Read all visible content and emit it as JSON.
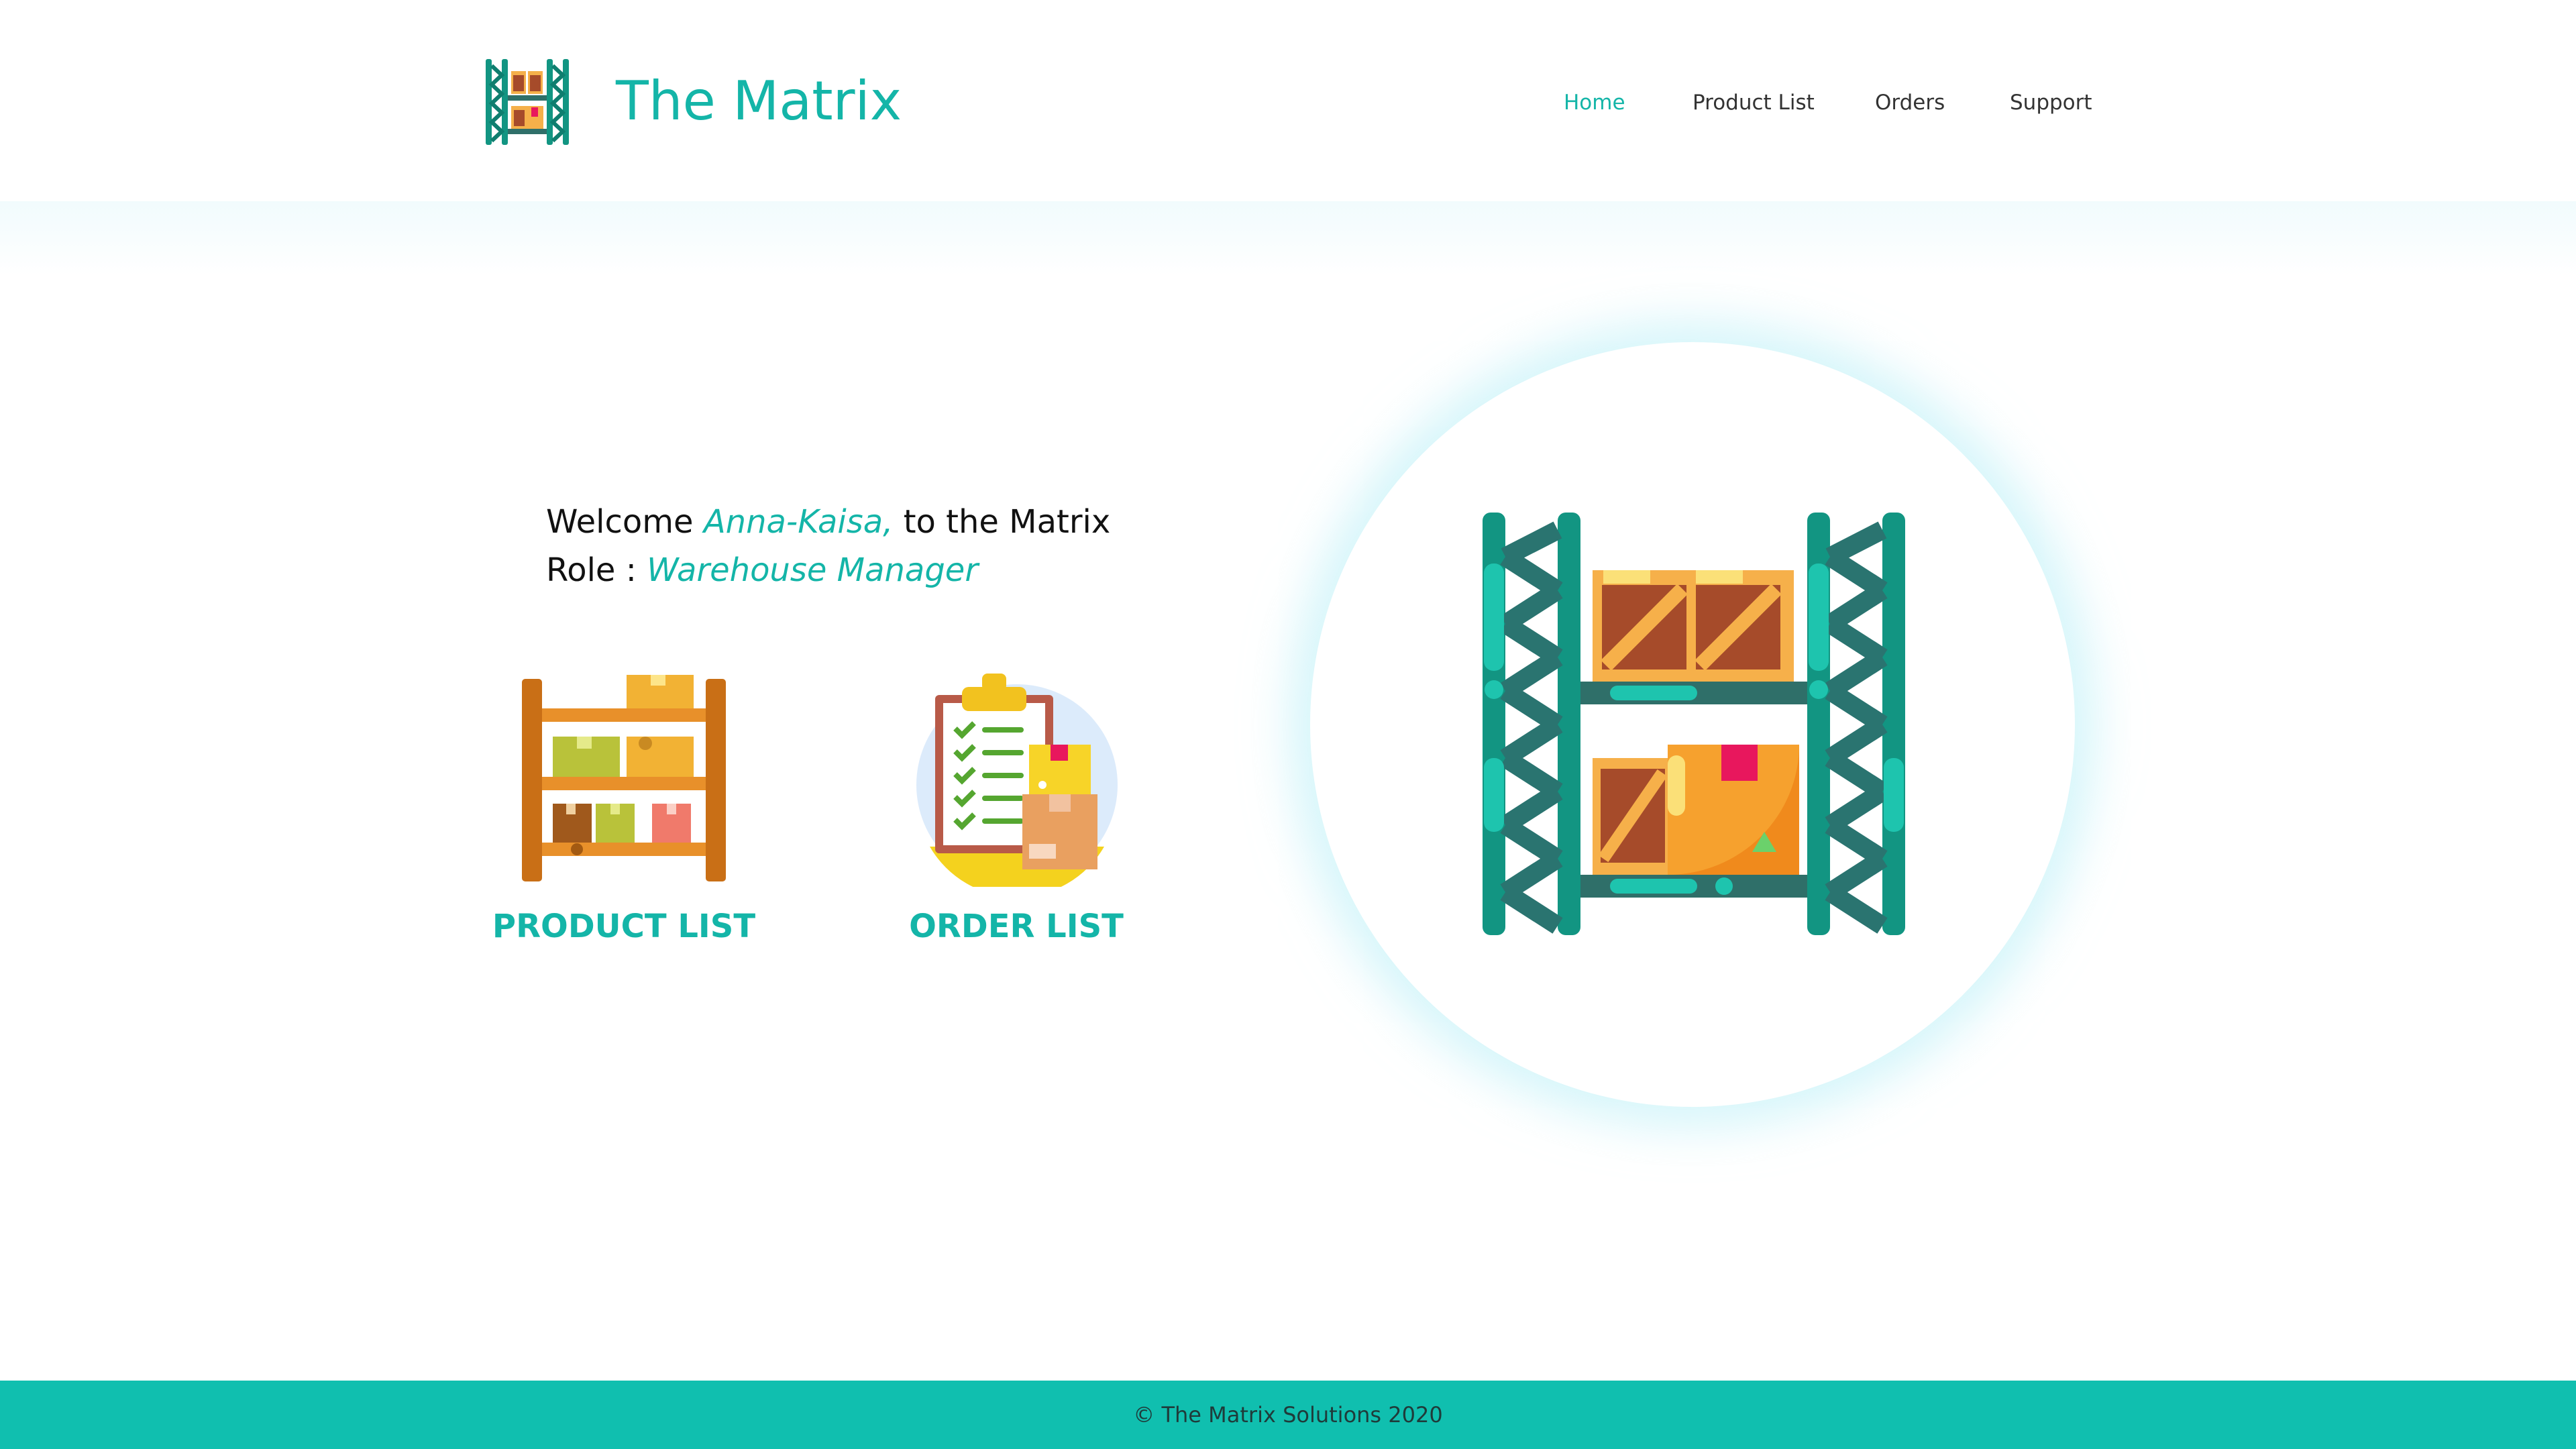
{
  "brand": {
    "title": "The Matrix",
    "logo_icon": "warehouse-shelf-icon"
  },
  "nav": {
    "home": "Home",
    "product_list": "Product List",
    "orders": "Orders",
    "support": "Support",
    "active": "Home"
  },
  "welcome": {
    "prefix": "Welcome ",
    "user_name": "Anna-Kaisa,",
    "suffix": " to the Matrix",
    "role_prefix": "Role : ",
    "role": "Warehouse Manager"
  },
  "tiles": {
    "product_list": {
      "label": "PRODUCT LIST",
      "icon": "shelf-boxes-icon"
    },
    "order_list": {
      "label": "ORDER LIST",
      "icon": "clipboard-checklist-icon"
    }
  },
  "hero": {
    "icon": "warehouse-rack-icon"
  },
  "footer": {
    "text": "© The Matrix Solutions 2020"
  },
  "colors": {
    "accent": "#14b5a8",
    "footer": "#10bfaf",
    "rack": "#129582",
    "box": "#f2a93b"
  }
}
